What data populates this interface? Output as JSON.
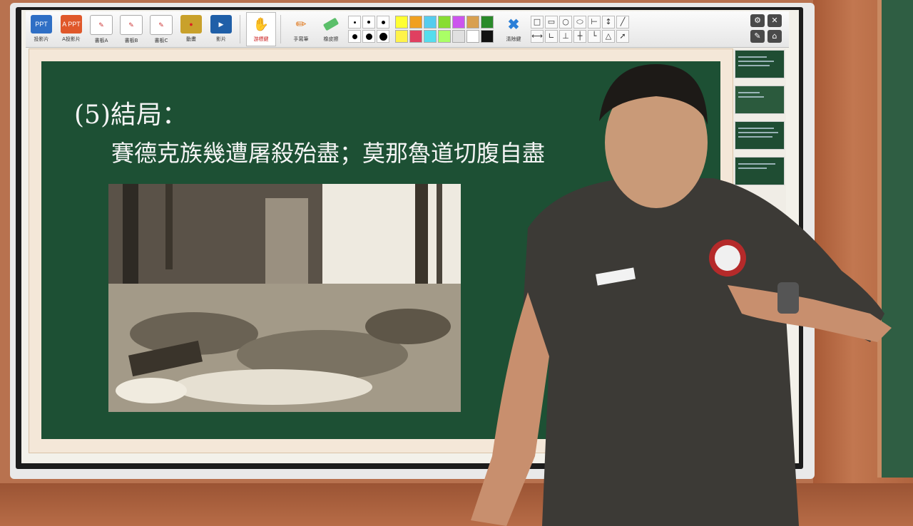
{
  "toolbar": {
    "buttons": [
      {
        "label": "投影片",
        "icon": "ppt-icon",
        "icon_text": "PPT",
        "color": "#2f6fc5"
      },
      {
        "label": "A投影片",
        "icon": "appt-icon",
        "icon_text": "A PPT",
        "color": "#e0582a"
      },
      {
        "label": "書板A",
        "icon": "board-a-icon",
        "icon_text": "",
        "color": "#ffffff"
      },
      {
        "label": "書板B",
        "icon": "board-b-icon",
        "icon_text": "",
        "color": "#ffffff"
      },
      {
        "label": "書板C",
        "icon": "board-c-icon",
        "icon_text": "",
        "color": "#ffffff"
      },
      {
        "label": "動畫",
        "icon": "animation-icon",
        "icon_text": "",
        "color": "#c9a12b"
      },
      {
        "label": "影片",
        "icon": "video-icon",
        "icon_text": "",
        "color": "#1f5fa8"
      }
    ],
    "pointer_label": "游標鍵",
    "pen_label": "手寫筆",
    "eraser_label": "橡皮擦",
    "clear_label": "清除鍵",
    "colors": [
      "#ffff33",
      "#f0a020",
      "#55ccee",
      "#88dd33",
      "#cc55ee",
      "#d8a050",
      "#2a8a2a",
      "#fff34a",
      "#e04060",
      "#55ddee",
      "#aaff66",
      "#e0e0e0",
      "#ffffff",
      "#111111"
    ]
  },
  "slide": {
    "title": "(5)結局：",
    "subtitle": "賽德克族幾遭屠殺殆盡；莫那魯道切腹自盡"
  }
}
